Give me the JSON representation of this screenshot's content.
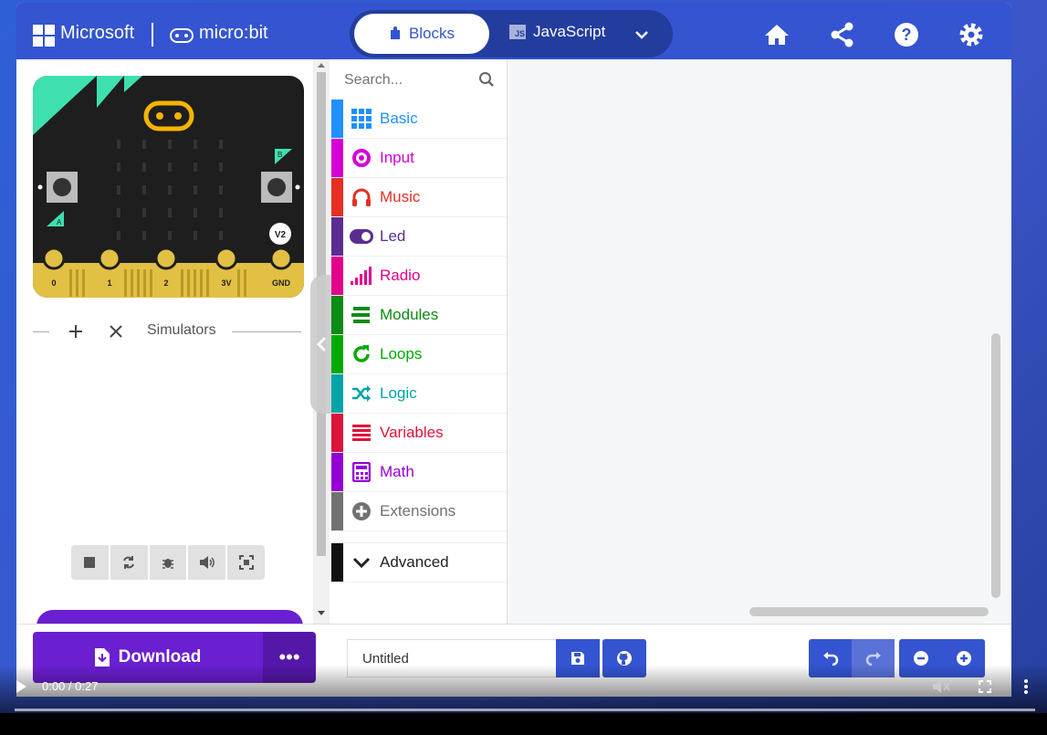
{
  "header": {
    "brand": "Microsoft",
    "product": "micro:bit",
    "tabs": [
      {
        "label": "Blocks",
        "active": true
      },
      {
        "label": "JavaScript",
        "active": false
      }
    ],
    "icons": [
      "home-icon",
      "share-icon",
      "help-icon",
      "settings-icon"
    ]
  },
  "simulator": {
    "pins": [
      "0",
      "1",
      "2",
      "3V",
      "GND"
    ],
    "button_a": "A",
    "button_b": "B",
    "version_badge": "V2",
    "label": "Simulators",
    "controls": [
      "stop-icon",
      "restart-icon",
      "debug-icon",
      "sound-icon",
      "fullscreen-icon"
    ]
  },
  "toolbox": {
    "search_placeholder": "Search...",
    "categories": [
      {
        "label": "Basic",
        "color": "#1e90ff"
      },
      {
        "label": "Input",
        "color": "#d400d4"
      },
      {
        "label": "Music",
        "color": "#e63022"
      },
      {
        "label": "Led",
        "color": "#5c2d91"
      },
      {
        "label": "Radio",
        "color": "#e3008c"
      },
      {
        "label": "Modules",
        "color": "#0e8a16"
      },
      {
        "label": "Loops",
        "color": "#00aa00"
      },
      {
        "label": "Logic",
        "color": "#00a4a6"
      },
      {
        "label": "Variables",
        "color": "#dc143c"
      },
      {
        "label": "Math",
        "color": "#9400d3"
      },
      {
        "label": "Extensions",
        "color": "#717171"
      }
    ],
    "advanced": "Advanced"
  },
  "footer": {
    "download_label": "Download",
    "more_label": "•••",
    "project_name": "Untitled"
  },
  "video": {
    "time": "0:00 / 0:27"
  }
}
